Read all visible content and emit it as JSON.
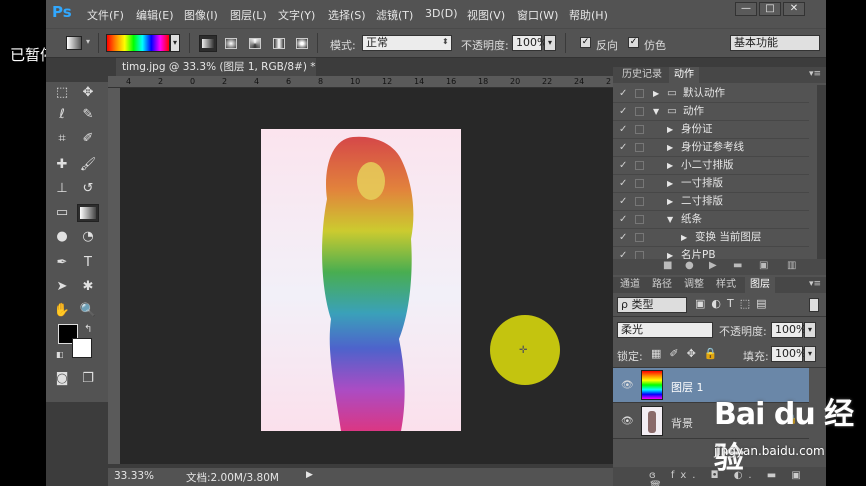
{
  "overlay": {
    "paused_label": "已暂停"
  },
  "app": {
    "logo": "Ps",
    "menu": [
      "文件(F)",
      "编辑(E)",
      "图像(I)",
      "图层(L)",
      "文字(Y)",
      "选择(S)",
      "滤镜(T)",
      "3D(D)",
      "视图(V)",
      "窗口(W)",
      "帮助(H)"
    ],
    "window_buttons": [
      "—",
      "□",
      "✕"
    ]
  },
  "options": {
    "mode_label": "模式:",
    "mode_value": "正常",
    "opacity_label": "不透明度:",
    "opacity_value": "100%",
    "reverse_label": "反向",
    "dither_label": "仿色",
    "workspace": "基本功能"
  },
  "document": {
    "tab_title": "timg.jpg @ 33.3% (图层 1, RGB/8#) *",
    "tab_close": "×",
    "zoom": "33.33%",
    "doc_info": "文档:2.00M/3.80M",
    "ruler_ticks": [
      "4",
      "2",
      "0",
      "2",
      "4",
      "6",
      "8",
      "10",
      "12",
      "14",
      "16",
      "18",
      "20",
      "22",
      "24",
      "2"
    ]
  },
  "actions_panel": {
    "tabs": [
      "历史记录",
      "动作"
    ],
    "items": [
      {
        "label": "默认动作",
        "level": 0,
        "expanded": false,
        "folder": true
      },
      {
        "label": "动作",
        "level": 0,
        "expanded": true,
        "folder": true
      },
      {
        "label": "身份证",
        "level": 1,
        "expanded": false,
        "folder": false
      },
      {
        "label": "身份证参考线",
        "level": 1,
        "expanded": false,
        "folder": false
      },
      {
        "label": "小二寸排版",
        "level": 1,
        "expanded": false,
        "folder": false
      },
      {
        "label": "一寸排版",
        "level": 1,
        "expanded": false,
        "folder": false
      },
      {
        "label": "二寸排版",
        "level": 1,
        "expanded": false,
        "folder": false
      },
      {
        "label": "纸条",
        "level": 1,
        "expanded": true,
        "folder": false
      },
      {
        "label": "变换 当前图层",
        "level": 2,
        "expanded": false,
        "folder": false
      },
      {
        "label": "名片PB",
        "level": 1,
        "expanded": false,
        "folder": false
      }
    ]
  },
  "layers_panel": {
    "tabs": [
      "通道",
      "路径",
      "调整",
      "样式",
      "图层"
    ],
    "filter_label": "ρ 类型",
    "blend_mode": "柔光",
    "opacity_label": "不透明度:",
    "opacity_value": "100%",
    "lock_label": "锁定:",
    "fill_label": "填充:",
    "fill_value": "100%",
    "layers": [
      {
        "name": "图层 1",
        "selected": true
      },
      {
        "name": "背景",
        "selected": false
      }
    ],
    "bottom_icons": "ɞ fx. ◘ ◐. ▬ ▣ 🗑"
  },
  "watermark": {
    "brand": "Bai du 经验",
    "url": "jingyan.baidu.com"
  },
  "colors": {
    "accent": "#31a8ff",
    "panel": "#535353",
    "canvas": "#282828",
    "selected_layer": "#6a87a8",
    "cursor": "#c4c40f"
  }
}
